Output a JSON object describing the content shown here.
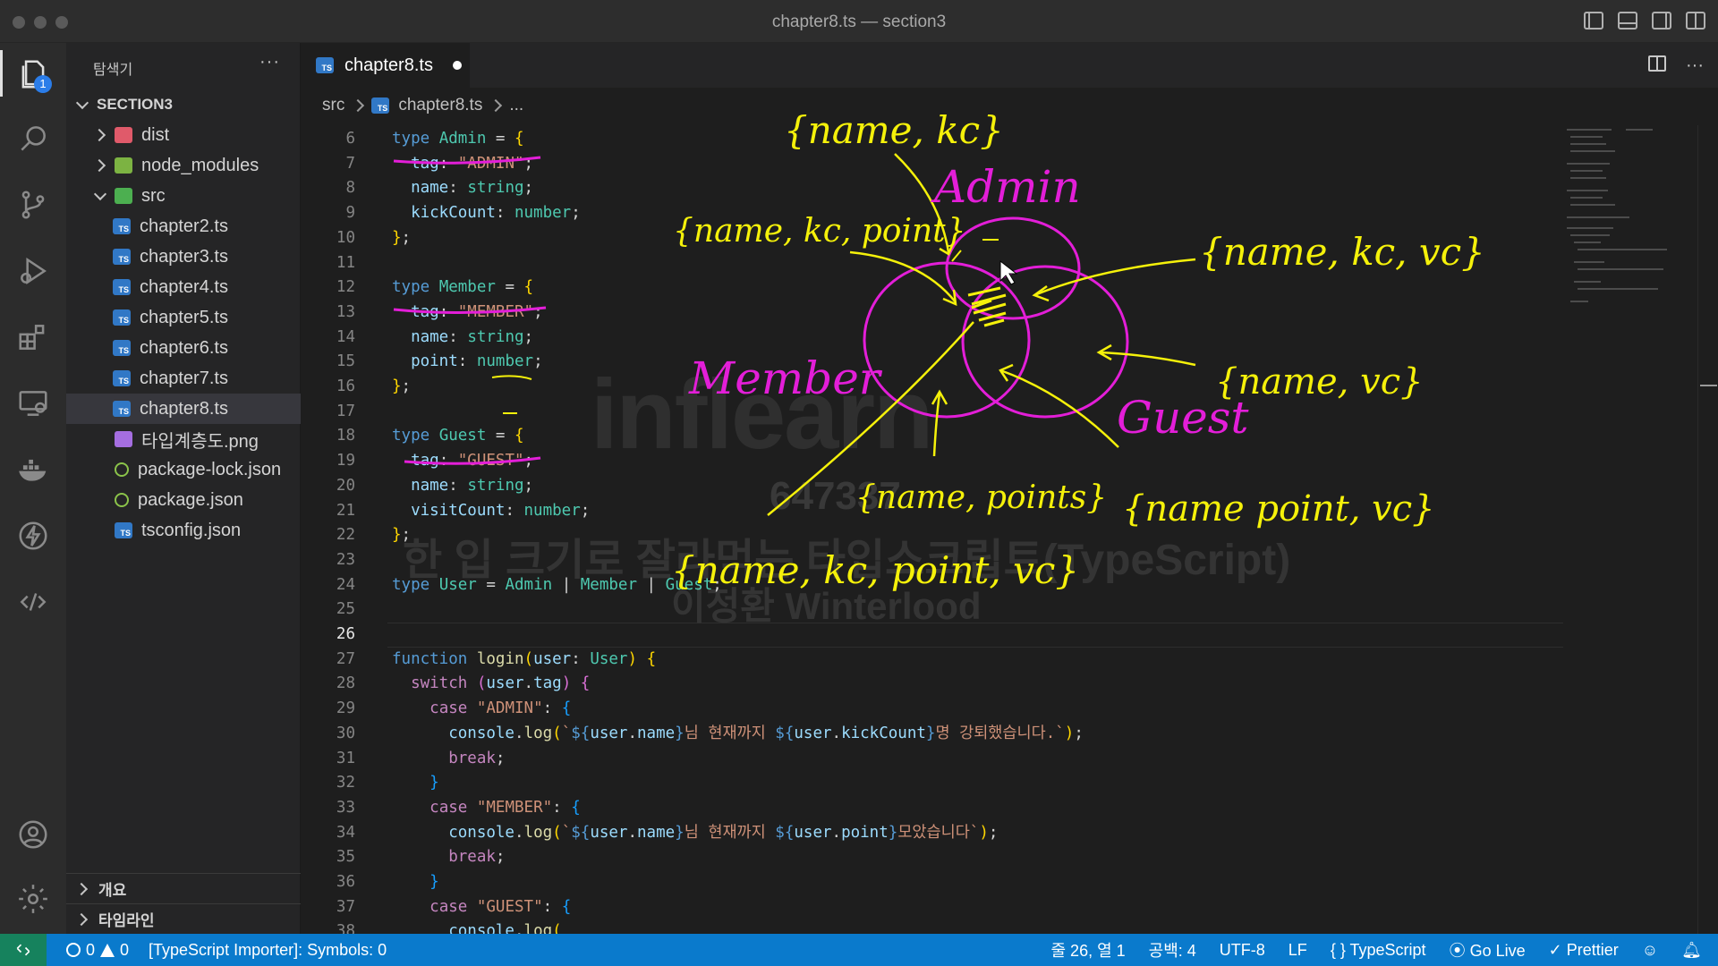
{
  "window": {
    "title": "chapter8.ts — section3"
  },
  "activity_bar": {
    "explorer_badge": "1"
  },
  "sidebar": {
    "header": "탐색기",
    "more": "···",
    "root": "SECTION3",
    "tree": [
      {
        "label": "dist",
        "kind": "folder",
        "indent": 1,
        "chevron": "right",
        "icon": "folder-red"
      },
      {
        "label": "node_modules",
        "kind": "folder",
        "indent": 1,
        "chevron": "right",
        "icon": "folder-green"
      },
      {
        "label": "src",
        "kind": "folder",
        "indent": 1,
        "chevron": "down",
        "icon": "folder-src"
      },
      {
        "label": "chapter2.ts",
        "kind": "file",
        "indent": 2,
        "icon": "ts"
      },
      {
        "label": "chapter3.ts",
        "kind": "file",
        "indent": 2,
        "icon": "ts"
      },
      {
        "label": "chapter4.ts",
        "kind": "file",
        "indent": 2,
        "icon": "ts"
      },
      {
        "label": "chapter5.ts",
        "kind": "file",
        "indent": 2,
        "icon": "ts"
      },
      {
        "label": "chapter6.ts",
        "kind": "file",
        "indent": 2,
        "icon": "ts"
      },
      {
        "label": "chapter7.ts",
        "kind": "file",
        "indent": 2,
        "icon": "ts"
      },
      {
        "label": "chapter8.ts",
        "kind": "file",
        "indent": 2,
        "icon": "ts",
        "selected": true
      },
      {
        "label": "타입계층도.png",
        "kind": "file",
        "indent": 1,
        "icon": "img"
      },
      {
        "label": "package-lock.json",
        "kind": "file",
        "indent": 1,
        "icon": "json"
      },
      {
        "label": "package.json",
        "kind": "file",
        "indent": 1,
        "icon": "json"
      },
      {
        "label": "tsconfig.json",
        "kind": "file",
        "indent": 1,
        "icon": "ts"
      }
    ],
    "outline": "개요",
    "timeline": "타임라인"
  },
  "tabs": [
    {
      "label": "chapter8.ts",
      "dirty": true,
      "icon_text": "TS"
    }
  ],
  "breadcrumb": {
    "folder": "src",
    "file": "chapter8.ts",
    "more": "..."
  },
  "editor": {
    "current_line": 26,
    "lines": [
      {
        "n": 6,
        "html": "<span class='kw'>type</span> <span class='ty'>Admin</span> = <span class='br1'>{</span>"
      },
      {
        "n": 7,
        "html": "  <span class='var'>tag</span>: <span class='str'>\"ADMIN\"</span>;"
      },
      {
        "n": 8,
        "html": "  <span class='var'>name</span>: <span class='ty'>string</span>;"
      },
      {
        "n": 9,
        "html": "  <span class='var'>kickCount</span>: <span class='ty'>number</span>;"
      },
      {
        "n": 10,
        "html": "<span class='br1'>}</span>;"
      },
      {
        "n": 11,
        "html": ""
      },
      {
        "n": 12,
        "html": "<span class='kw'>type</span> <span class='ty'>Member</span> = <span class='br1'>{</span>"
      },
      {
        "n": 13,
        "html": "  <span class='var'>tag</span>: <span class='str'>\"MEMBER\"</span>;"
      },
      {
        "n": 14,
        "html": "  <span class='var'>name</span>: <span class='ty'>string</span>;"
      },
      {
        "n": 15,
        "html": "  <span class='var'>point</span>: <span class='ty'>number</span>;"
      },
      {
        "n": 16,
        "html": "<span class='br1'>}</span>;"
      },
      {
        "n": 17,
        "html": ""
      },
      {
        "n": 18,
        "html": "<span class='kw'>type</span> <span class='ty'>Guest</span> = <span class='br1'>{</span>"
      },
      {
        "n": 19,
        "html": "  <span class='var'>tag</span>: <span class='str'>\"GUEST\"</span>;"
      },
      {
        "n": 20,
        "html": "  <span class='var'>name</span>: <span class='ty'>string</span>;"
      },
      {
        "n": 21,
        "html": "  <span class='var'>visitCount</span>: <span class='ty'>number</span>;"
      },
      {
        "n": 22,
        "html": "<span class='br1'>}</span>;"
      },
      {
        "n": 23,
        "html": ""
      },
      {
        "n": 24,
        "html": "<span class='kw'>type</span> <span class='ty'>User</span> = <span class='ty'>Admin</span> | <span class='ty'>Member</span> | <span class='ty'>Guest</span>;"
      },
      {
        "n": 25,
        "html": ""
      },
      {
        "n": 26,
        "html": ""
      },
      {
        "n": 27,
        "html": "<span class='kw'>function</span> <span class='fn'>login</span><span class='br1'>(</span><span class='var'>user</span>: <span class='ty'>User</span><span class='br1'>)</span> <span class='br1'>{</span>"
      },
      {
        "n": 28,
        "html": "  <span class='ctl'>switch</span> <span class='br2'>(</span><span class='var'>user</span>.<span class='var'>tag</span><span class='br2'>)</span> <span class='br2'>{</span>"
      },
      {
        "n": 29,
        "html": "    <span class='ctl'>case</span> <span class='str'>\"ADMIN\"</span>: <span class='br3'>{</span>"
      },
      {
        "n": 30,
        "html": "      <span class='var'>console</span>.<span class='fn'>log</span><span class='br1'>(</span><span class='str'>`</span><span class='tpl'>${</span><span class='var'>user</span>.<span class='var'>name</span><span class='tpl'>}</span><span class='str'>님 현재까지 </span><span class='tpl'>${</span><span class='var'>user</span>.<span class='var'>kickCount</span><span class='tpl'>}</span><span class='str'>명 강퇴했습니다.`</span><span class='br1'>)</span>;"
      },
      {
        "n": 31,
        "html": "      <span class='ctl'>break</span>;"
      },
      {
        "n": 32,
        "html": "    <span class='br3'>}</span>"
      },
      {
        "n": 33,
        "html": "    <span class='ctl'>case</span> <span class='str'>\"MEMBER\"</span>: <span class='br3'>{</span>"
      },
      {
        "n": 34,
        "html": "      <span class='var'>console</span>.<span class='fn'>log</span><span class='br1'>(</span><span class='str'>`</span><span class='tpl'>${</span><span class='var'>user</span>.<span class='var'>name</span><span class='tpl'>}</span><span class='str'>님 현재까지 </span><span class='tpl'>${</span><span class='var'>user</span>.<span class='var'>point</span><span class='tpl'>}</span><span class='str'>모았습니다`</span><span class='br1'>)</span>;"
      },
      {
        "n": 35,
        "html": "      <span class='ctl'>break</span>;"
      },
      {
        "n": 36,
        "html": "    <span class='br3'>}</span>"
      },
      {
        "n": 37,
        "html": "    <span class='ctl'>case</span> <span class='str'>\"GUEST\"</span>: <span class='br3'>{</span>"
      },
      {
        "n": 38,
        "html": "      <span class='var'>console</span>.<span class='fn'>log</span><span class='br1'>(</span>"
      }
    ]
  },
  "watermark": {
    "logo": "inflearn",
    "id": "647337",
    "course": "한 입 크기로 잘라먹는 타입스크립트(TypeScript)",
    "author": "이정환 Winterlood"
  },
  "annotations": {
    "admin_label": "Admin",
    "member_label": "Member",
    "guest_label": "Guest",
    "admin_set": "{name, kc}",
    "admin_member_set": "{name, kc, point}",
    "admin_guest_set": "{name, kc, vc}",
    "guest_set": "{name, vc}",
    "member_set": "{name, points}",
    "member_guest_set": "{name point, vc}",
    "all_set": "{name, kc, point, vc}",
    "ink_yellow": "#f5f10a",
    "ink_magenta": "#e31ed8"
  },
  "statusbar": {
    "errors": "0",
    "warnings": "0",
    "message": "[TypeScript Importer]: Symbols: 0",
    "position": "줄 26, 열 1",
    "indent": "공백: 4",
    "encoding": "UTF-8",
    "eol": "LF",
    "language": "TypeScript",
    "golive": "Go Live",
    "prettier": "Prettier"
  }
}
